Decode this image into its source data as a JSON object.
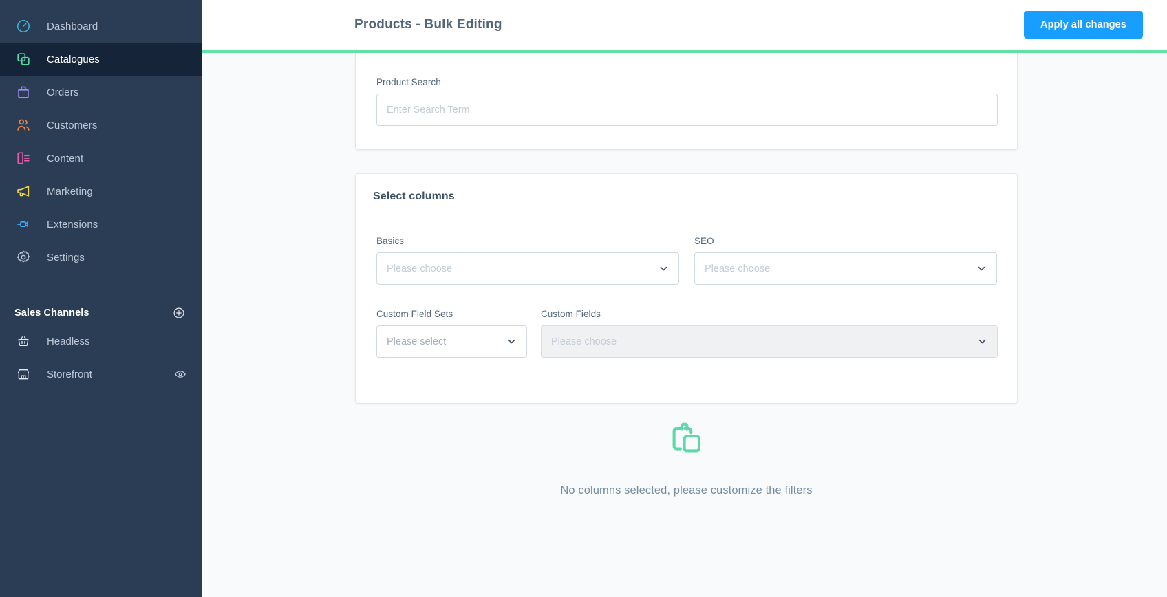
{
  "colors": {
    "sidebar_bg": "#2b3d54",
    "sidebar_active_bg": "#16243a",
    "accent_blue": "#189eff",
    "progress_green": "#62e2a4",
    "empty_icon_green": "#5cd9a6",
    "text_muted": "#758ca3"
  },
  "sidebar": {
    "items": [
      {
        "label": "Dashboard",
        "icon": "dashboard-gauge-icon",
        "color": "#34b6d9",
        "active": false
      },
      {
        "label": "Catalogues",
        "icon": "catalogues-copy-icon",
        "color": "#5cd9a6",
        "active": true
      },
      {
        "label": "Orders",
        "icon": "orders-bag-icon",
        "color": "#a58cf2",
        "active": false
      },
      {
        "label": "Customers",
        "icon": "customers-people-icon",
        "color": "#f2853f",
        "active": false
      },
      {
        "label": "Content",
        "icon": "content-document-icon",
        "color": "#ed5faa",
        "active": false
      },
      {
        "label": "Marketing",
        "icon": "marketing-megaphone-icon",
        "color": "#f5d442",
        "active": false
      },
      {
        "label": "Extensions",
        "icon": "extensions-plug-icon",
        "color": "#3ba9f5",
        "active": false
      },
      {
        "label": "Settings",
        "icon": "settings-gear-icon",
        "color": "#b6c1ce",
        "active": false
      }
    ],
    "sales_channels": {
      "title": "Sales Channels",
      "add_icon": "plus-circle-icon",
      "channels": [
        {
          "label": "Headless",
          "icon": "basket-icon",
          "trailing_icon": null
        },
        {
          "label": "Storefront",
          "icon": "shop-icon",
          "trailing_icon": "eye-icon"
        }
      ]
    }
  },
  "topbar": {
    "title": "Products - Bulk Editing",
    "apply_button": "Apply all changes"
  },
  "search_card": {
    "label": "Product Search",
    "placeholder": "Enter Search Term",
    "value": ""
  },
  "columns_card": {
    "title": "Select columns",
    "fields": [
      {
        "label": "Basics",
        "placeholder": "Please choose",
        "disabled": false,
        "chevron": "chevron-down-icon"
      },
      {
        "label": "SEO",
        "placeholder": "Please choose",
        "disabled": false,
        "chevron": "chevron-down-icon"
      },
      {
        "label": "Custom Field Sets",
        "placeholder": "Please select",
        "disabled": false,
        "chevron": "chevron-down-icon"
      },
      {
        "label": "Custom Fields",
        "placeholder": "Please choose",
        "disabled": true,
        "chevron": "chevron-down-icon"
      }
    ]
  },
  "empty_state": {
    "icon": "products-empty-icon",
    "message": "No columns selected, please customize the filters"
  }
}
